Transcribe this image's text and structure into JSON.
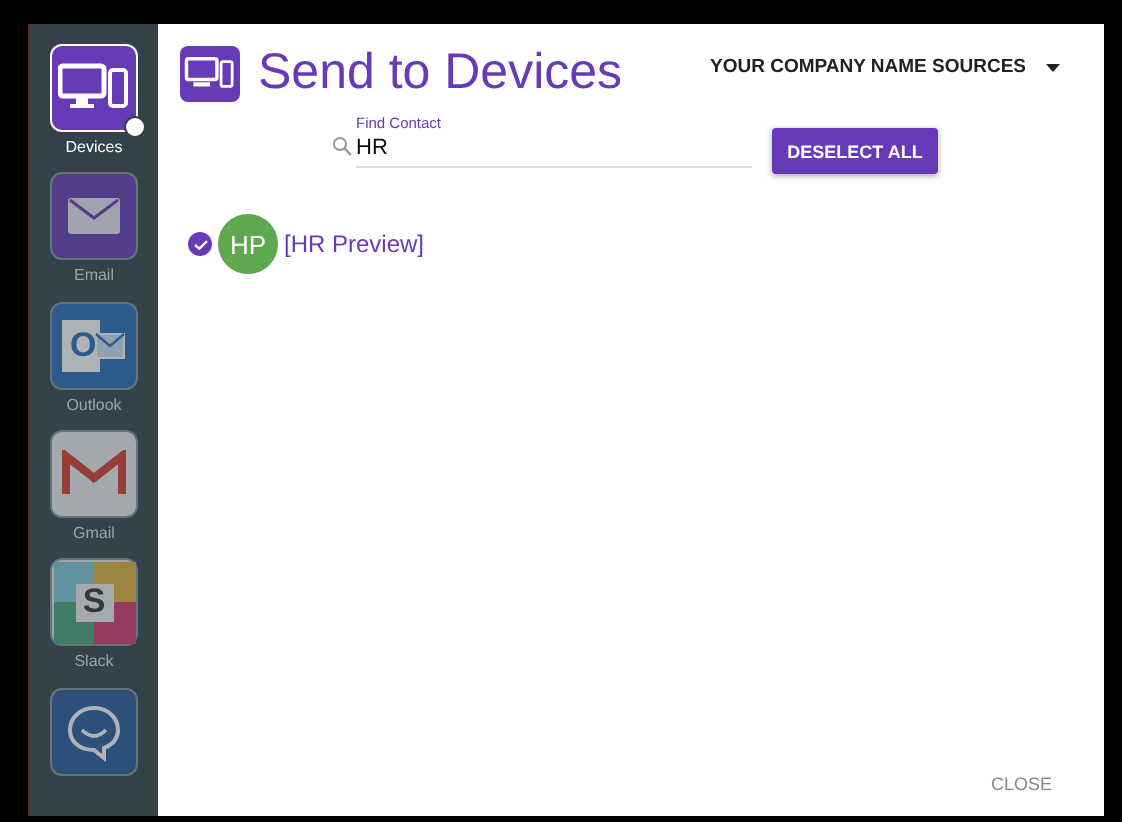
{
  "sidebar": {
    "items": [
      {
        "kind": "devices",
        "label": "Devices",
        "selected": true
      },
      {
        "kind": "email",
        "label": "Email",
        "selected": false
      },
      {
        "kind": "outlook",
        "label": "Outlook",
        "glyph": "O",
        "selected": false
      },
      {
        "kind": "gmail",
        "label": "Gmail",
        "selected": false
      },
      {
        "kind": "slack",
        "label": "Slack",
        "glyph": "S",
        "selected": false
      },
      {
        "kind": "chat",
        "selected": false
      }
    ]
  },
  "header": {
    "title": "Send to Devices",
    "source_menu": "YOUR COMPANY NAME SOURCES"
  },
  "search": {
    "label": "Find Contact",
    "value": "HR"
  },
  "deselect_button": "DESELECT ALL",
  "contacts": [
    {
      "initials": "HP",
      "name": "[HR Preview]",
      "checked": true,
      "color": "#5fa84f"
    }
  ],
  "close_button": "CLOSE"
}
